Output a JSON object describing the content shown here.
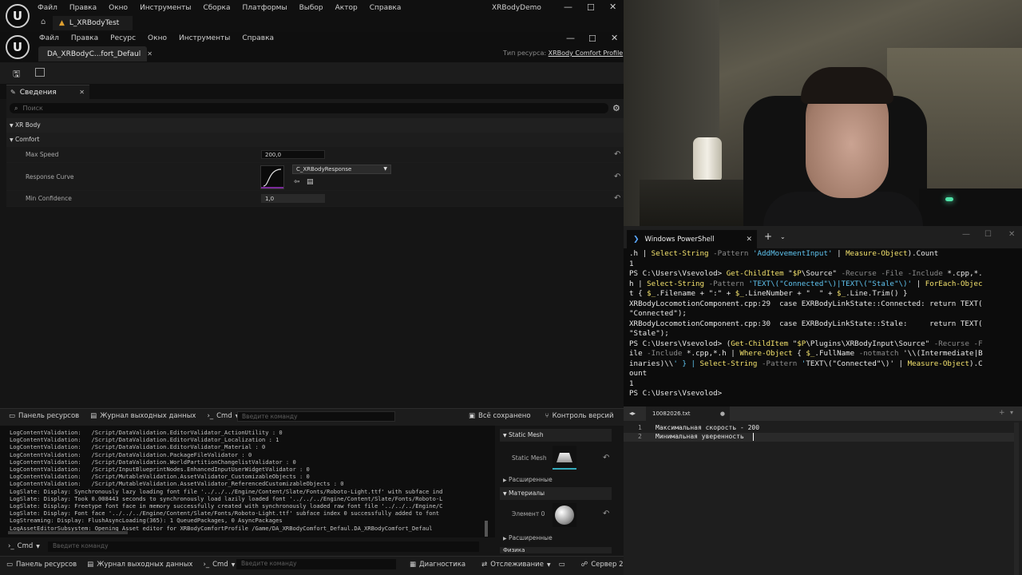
{
  "ue": {
    "main_menu": [
      "Файл",
      "Правка",
      "Окно",
      "Инструменты",
      "Сборка",
      "Платформы",
      "Выбор",
      "Актор",
      "Справка"
    ],
    "window_title": "XRBodyDemo",
    "level_tab": "L_XRBodyTest",
    "asset_menu": [
      "Файл",
      "Правка",
      "Ресурс",
      "Окно",
      "Инструменты",
      "Справка"
    ],
    "asset_tab": "DA_XRBodyC...fort_Defaul",
    "asset_type_label": "Тип ресурса:",
    "asset_type_value": "XRBody Comfort Profile",
    "details_tab": "Сведения",
    "search_placeholder": "Поиск",
    "category_xrbody": "XR Body",
    "category_comfort": "Comfort",
    "max_speed_label": "Max Speed",
    "max_speed_value": "200,0",
    "response_curve_label": "Response Curve",
    "response_curve_value": "C_XRBodyResponse",
    "min_confidence_label": "Min Confidence",
    "min_confidence_value": "1,0",
    "bottom_tabs": {
      "content": "Панель ресурсов",
      "output_log": "Журнал выходных данных",
      "cmd": "Cmd",
      "cmd_placeholder": "Введите команду",
      "saved": "Всё сохранено",
      "revision": "Контроль версий"
    },
    "log_lines": [
      "LogContentValidation:   /Script/DataValidation.EditorValidator_ActionUtility : 0",
      "LogContentValidation:   /Script/DataValidation.EditorValidator_Localization : 1",
      "LogContentValidation:   /Script/DataValidation.EditorValidator_Material : 0",
      "LogContentValidation:   /Script/DataValidation.PackageFileValidator : 0",
      "LogContentValidation:   /Script/DataValidation.WorldPartitionChangelistValidator : 0",
      "LogContentValidation:   /Script/InputBlueprintNodes.EnhancedInputUserWidgetValidator : 0",
      "LogContentValidation:   /Script/MutableValidation.AssetValidator_CustomizableObjects : 0",
      "LogContentValidation:   /Script/MutableValidation.AssetValidator_ReferencedCustomizableObjects : 0",
      "LogSlate: Display: Synchronously lazy loading font file '../../../Engine/Content/Slate/Fonts/Roboto-Light.ttf' with subface ind",
      "LogSlate: Display: Took 0.008443 seconds to synchronously load lazily loaded font '../../../Engine/Content/Slate/Fonts/Roboto-L",
      "LogSlate: Display: Freetype font face in memory successfully created with synchronously loaded raw font file '../../../Engine/C",
      "LogSlate: Display: Font face '../../../Engine/Content/Slate/Fonts/Roboto-Light.ttf' subface index 0 successfully added to font",
      "LogStreaming: Display: FlushAsyncLoading(365): 1 QueuedPackages, 0 AsyncPackages",
      "LogAssetEditorSubsystem: Opening Asset editor for XRBodyComfortProfile /Game/DA_XRBodyComfort_Defaul.DA_XRBodyComfort_Defaul"
    ],
    "side": {
      "static_mesh_header": "Static Mesh",
      "static_mesh_label": "Static Mesh",
      "advanced1": "Расширенные",
      "materials_header": "Материалы",
      "element0": "Элемент 0",
      "advanced2": "Расширенные",
      "next_header": "Физика"
    },
    "status_bar": {
      "content": "Панель ресурсов",
      "output_log": "Журнал выходных данных",
      "cmd": "Cmd",
      "cmd_placeholder": "Введите команду",
      "diagnostics": "Диагностика",
      "tracking": "Отслеживание",
      "server": "Сервер 2"
    }
  },
  "powershell": {
    "tab_title": "Windows PowerShell",
    "lines": [
      ".h | Select-String -Pattern 'AddMovementInput' | Measure-Object).Count",
      "1",
      "PS C:\\Users\\Vsevolod> Get-ChildItem \"$P\\Source\" -Recurse -File -Include *.cpp,*.",
      "h | Select-String -Pattern 'TEXT\\(\"Connected\"\\)|TEXT\\(\"Stale\"\\)' | ForEach-Objec",
      "t { $_.Filename + \":\" + $_.LineNumber + \"  \" + $_.Line.Trim() }",
      "XRBodyLocomotionComponent.cpp:29  case EXRBodyLinkState::Connected: return TEXT(",
      "\"Connected\");",
      "XRBodyLocomotionComponent.cpp:30  case EXRBodyLinkState::Stale:     return TEXT(",
      "\"Stale\");",
      "PS C:\\Users\\Vsevolod> (Get-ChildItem \"$P\\Plugins\\XRBodyInput\\Source\" -Recurse -F",
      "ile -Include *.cpp,*.h | Where-Object { $_.FullName -notmatch '\\\\(Intermediate|B",
      "inaries)\\\\' } | Select-String -Pattern 'TEXT\\(\"Connected\"\\)' | Measure-Object).C",
      "ount",
      "1",
      "PS C:\\Users\\Vsevolod>"
    ]
  },
  "notepad": {
    "tab": "10082026.txt",
    "lines": [
      "Максимальная скорость - 200",
      "Минимальная уверенность "
    ]
  }
}
